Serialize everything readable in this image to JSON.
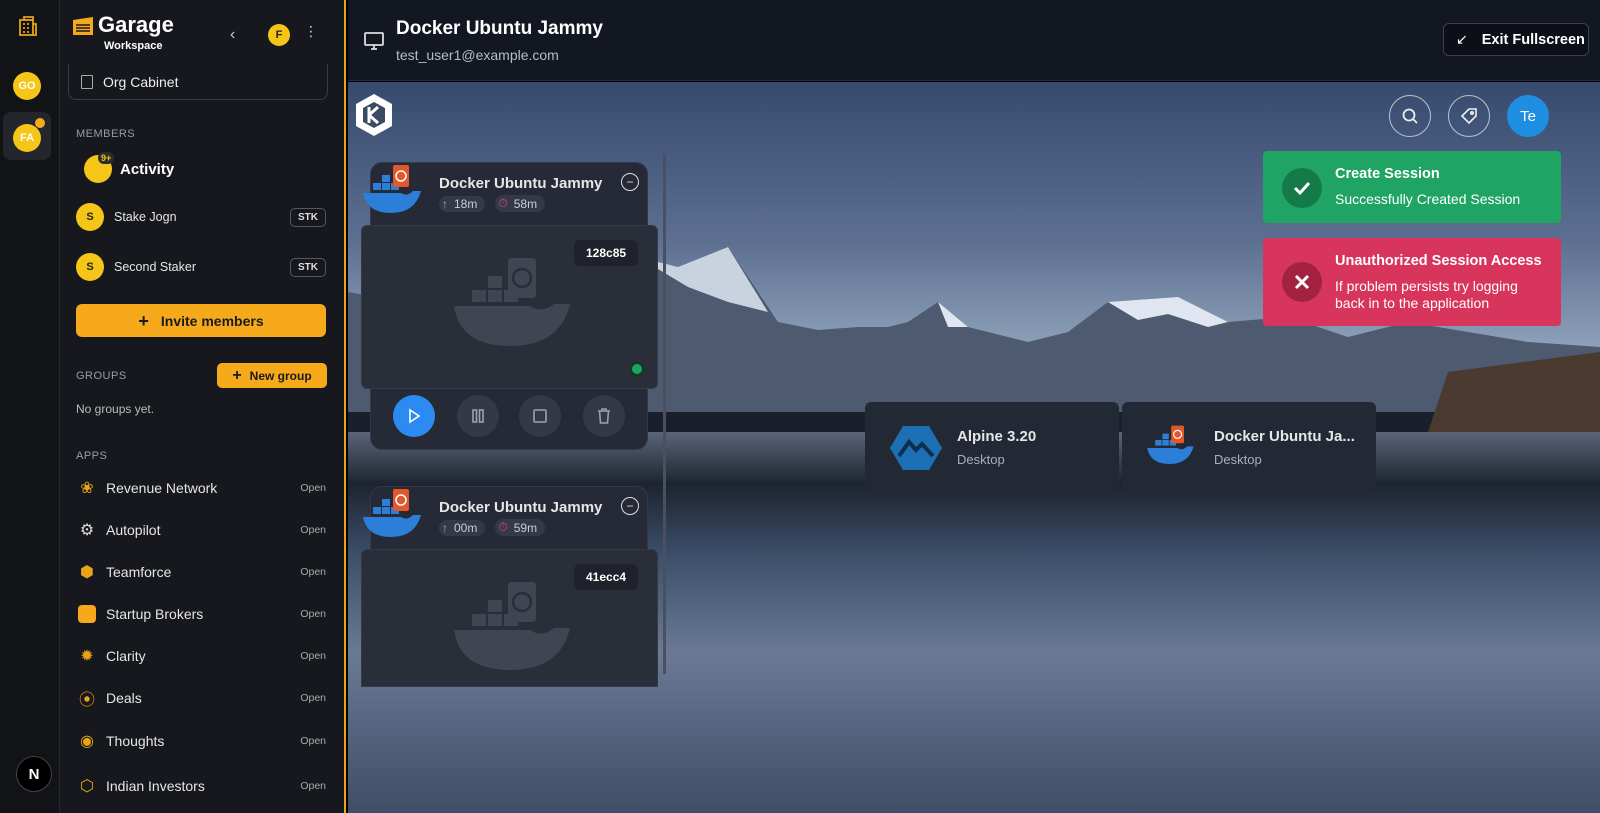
{
  "rail": {
    "avatars": [
      "GO",
      "FA"
    ],
    "bottom_logo": "N"
  },
  "sidebar": {
    "brand": {
      "name": "Garage",
      "subtitle": "Workspace"
    },
    "user_initial": "F",
    "org_cabinet": "Org Cabinet",
    "members_label": "MEMBERS",
    "activity": {
      "label": "Activity",
      "badge": "9+"
    },
    "members": [
      {
        "initial": "S",
        "name": "Stake Jogn",
        "tag": "STK"
      },
      {
        "initial": "S",
        "name": "Second Staker",
        "tag": "STK"
      }
    ],
    "invite_label": "Invite members",
    "groups_label": "GROUPS",
    "new_group_label": "New group",
    "no_groups": "No groups yet.",
    "apps_label": "APPS",
    "apps": [
      {
        "name": "Revenue Network",
        "action": "Open"
      },
      {
        "name": "Autopilot",
        "action": "Open"
      },
      {
        "name": "Teamforce",
        "action": "Open"
      },
      {
        "name": "Startup Brokers",
        "action": "Open"
      },
      {
        "name": "Clarity",
        "action": "Open"
      },
      {
        "name": "Deals",
        "action": "Open"
      },
      {
        "name": "Thoughts",
        "action": "Open"
      },
      {
        "name": "Indian Investors",
        "action": "Open"
      }
    ]
  },
  "header": {
    "title": "Docker Ubuntu Jammy",
    "email": "test_user1@example.com",
    "exit_label": "Exit Fullscreen"
  },
  "desktop": {
    "avatar": "Te",
    "sessions": [
      {
        "title": "Docker Ubuntu Jammy",
        "uptime": "18m",
        "remaining": "58m",
        "id": "128c85"
      },
      {
        "title": "Docker Ubuntu Jammy",
        "uptime": "00m",
        "remaining": "59m",
        "id": "41ecc4"
      }
    ],
    "apps": [
      {
        "name": "Alpine 3.20",
        "type": "Desktop"
      },
      {
        "name": "Docker Ubuntu Ja...",
        "type": "Desktop"
      }
    ]
  },
  "toasts": [
    {
      "title": "Create Session",
      "body": "Successfully Created Session",
      "color": "#1fa463"
    },
    {
      "title": "Unauthorized Session Access",
      "body": "If problem persists try logging back in to the application",
      "color": "#d8355c"
    }
  ],
  "colors": {
    "accent": "#f5a91b",
    "sidebar_bg": "#16181d",
    "topbar_bg": "#121722"
  }
}
